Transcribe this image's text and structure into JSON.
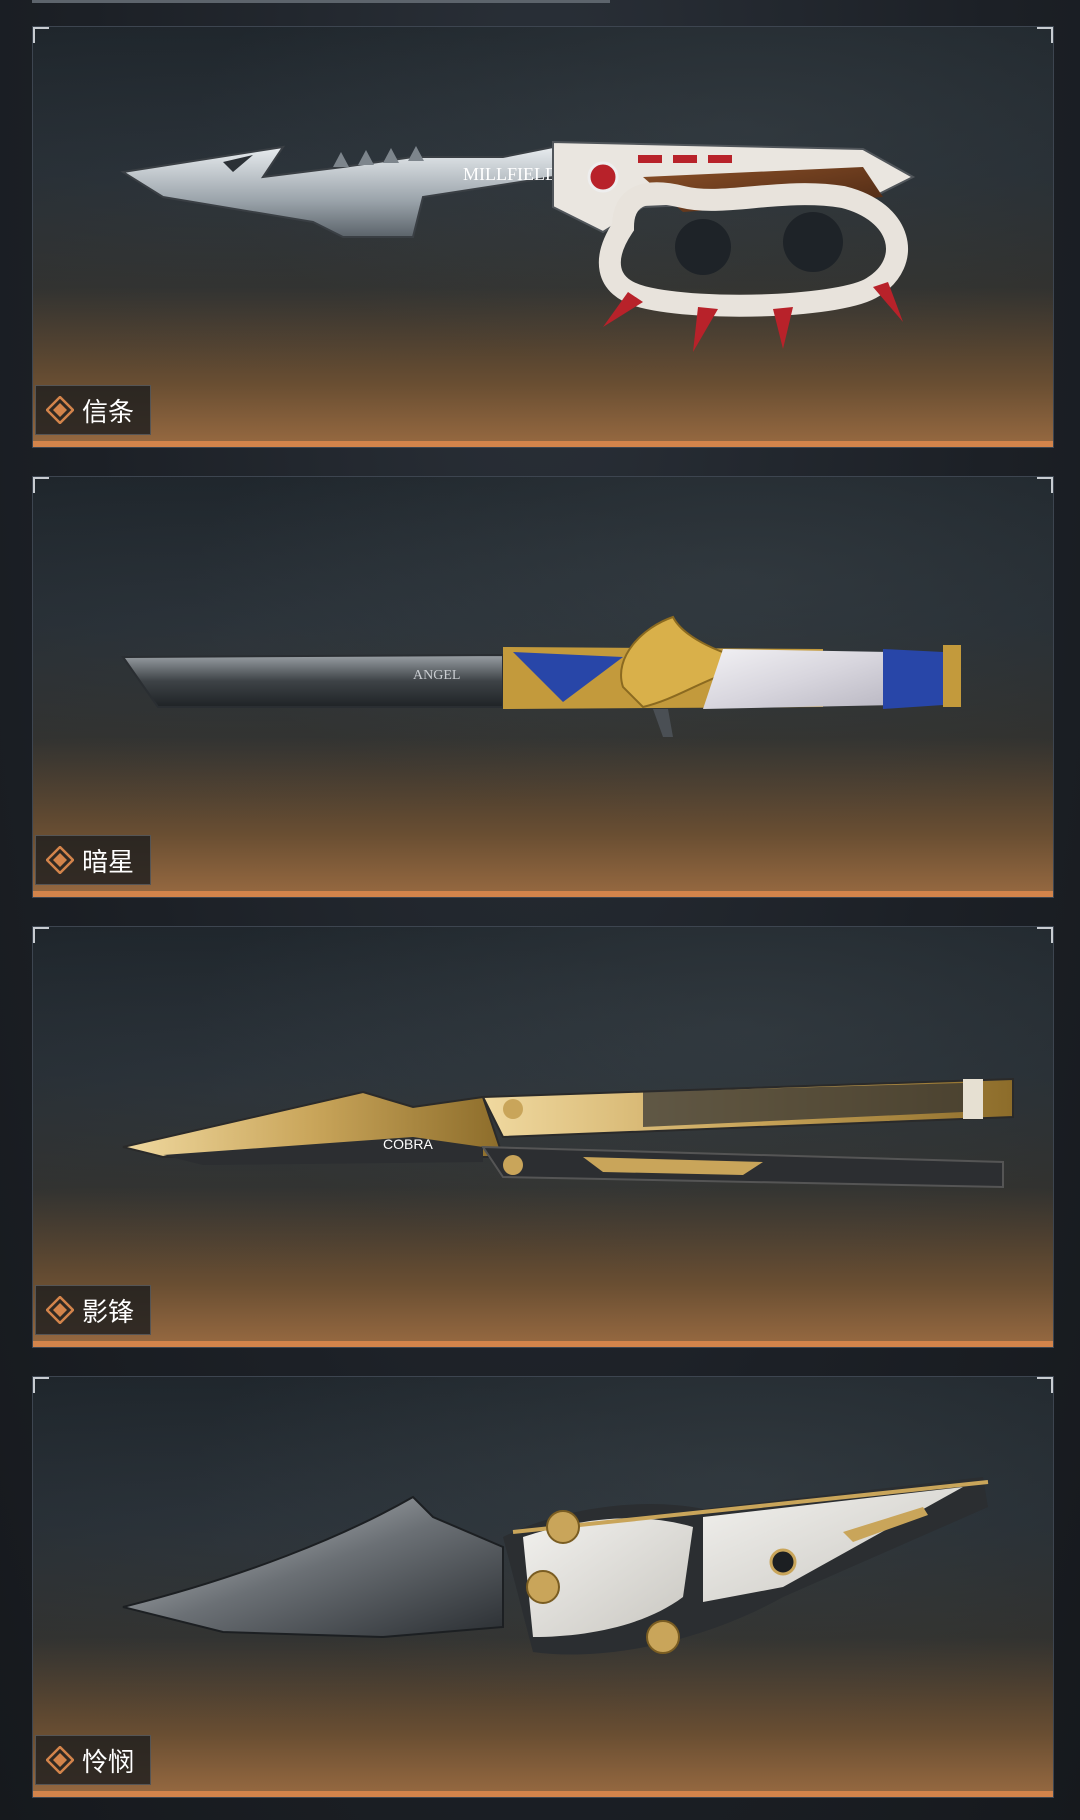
{
  "cards": [
    {
      "name": "信条",
      "icon": "diamond-icon"
    },
    {
      "name": "暗星",
      "icon": "diamond-icon"
    },
    {
      "name": "影锋",
      "icon": "diamond-icon"
    },
    {
      "name": "怜悯",
      "icon": "diamond-icon"
    }
  ],
  "weapon_marks": {
    "card0": "MILLFIELD",
    "card1": "ANGEL",
    "card2": "COBRA"
  },
  "colors": {
    "accent": "#d3844b",
    "label_bg": "#1e1e1e",
    "frame": "#c8ccd1"
  }
}
